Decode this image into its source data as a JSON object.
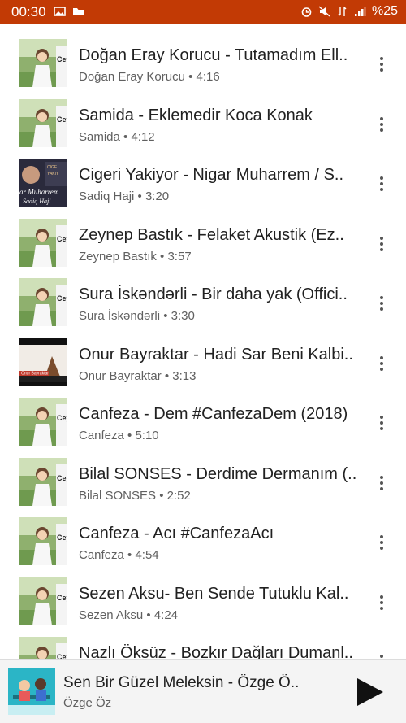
{
  "status_bar": {
    "time": "00:30",
    "battery": "%25",
    "background": "#c23a05"
  },
  "videos": [
    {
      "title": "Doğan Eray Korucu - Tutamadım Ell..",
      "meta": "Doğan Eray Korucu • 4:16",
      "thumb": "ceyl",
      "thumb_caption": "Ceyl"
    },
    {
      "title": "Samida - Eklemedir Koca Konak",
      "meta": "Samida • 4:12",
      "thumb": "ceyl",
      "thumb_caption": "Ceyl"
    },
    {
      "title": "Cigeri Yakiyor - Nigar Muharrem / S..",
      "meta": "Sadiq Haji • 3:20",
      "thumb": "dark",
      "thumb_caption": "ar Muharrem"
    },
    {
      "title": "Zeynep Bastık - Felaket Akustik (Ez..",
      "meta": "Zeynep Bastık • 3:57",
      "thumb": "ceyl",
      "thumb_caption": "Ceyl"
    },
    {
      "title": "Sura İskəndərli - Bir daha yak (Offici..",
      "meta": "Sura İskəndərli • 3:30",
      "thumb": "ceyl",
      "thumb_caption": "Ceyl"
    },
    {
      "title": "Onur Bayraktar - Hadi Sar Beni Kalbi..",
      "meta": "Onur Bayraktar • 3:13",
      "thumb": "red",
      "thumb_caption": "Onur Bayraktar"
    },
    {
      "title": "Canfeza - Dem #CanfezaDem (2018)",
      "meta": "Canfeza • 5:10",
      "thumb": "ceyl",
      "thumb_caption": "Ceyl"
    },
    {
      "title": "Bilal SONSES - Derdime Dermanım (..",
      "meta": "Bilal SONSES • 2:52",
      "thumb": "ceyl",
      "thumb_caption": "Ceyl"
    },
    {
      "title": "Canfeza - Acı #CanfezaAcı",
      "meta": "Canfeza • 4:54",
      "thumb": "ceyl",
      "thumb_caption": "Ceyl"
    },
    {
      "title": "Sezen Aksu- Ben Sende Tutuklu Kal..",
      "meta": "Sezen Aksu • 4:24",
      "thumb": "ceyl",
      "thumb_caption": "Ceyl"
    },
    {
      "title": "Nazlı Öksüz - Bozkır Dağları Dumanl..",
      "meta": "",
      "thumb": "ceyl",
      "thumb_caption": "Ceyl"
    }
  ],
  "mini_player": {
    "title": "Sen Bir Güzel Meleksin - Özge Ö..",
    "subtitle": "Özge Öz",
    "play_icon": "play-icon"
  }
}
